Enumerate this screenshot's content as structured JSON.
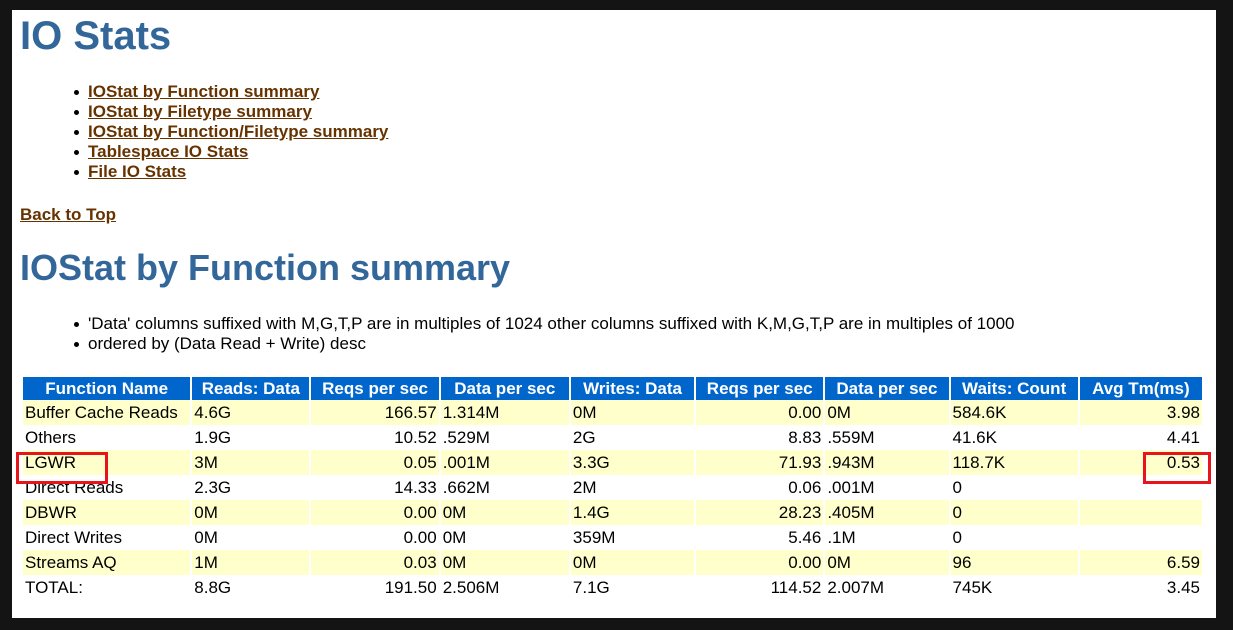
{
  "page_title": "IO Stats",
  "toc": [
    "IOStat by Function summary",
    "IOStat by Filetype summary",
    "IOStat by Function/Filetype summary",
    "Tablespace IO Stats",
    "File IO Stats"
  ],
  "back_to_top": "Back to Top",
  "section_title": "IOStat by Function summary",
  "notes": [
    "'Data' columns suffixed with M,G,T,P are in multiples of 1024 other columns suffixed with K,M,G,T,P are in multiples of 1000",
    "ordered by (Data Read + Write) desc"
  ],
  "table": {
    "headers": [
      "Function Name",
      "Reads: Data",
      "Reqs per sec",
      "Data per sec",
      "Writes: Data",
      "Reqs per sec",
      "Data per sec",
      "Waits: Count",
      "Avg Tm(ms)"
    ],
    "rows": [
      [
        "Buffer Cache Reads",
        "4.6G",
        "166.57",
        "1.314M",
        "0M",
        "0.00",
        "0M",
        "584.6K",
        "3.98"
      ],
      [
        "Others",
        "1.9G",
        "10.52",
        ".529M",
        "2G",
        "8.83",
        ".559M",
        "41.6K",
        "4.41"
      ],
      [
        "LGWR",
        "3M",
        "0.05",
        ".001M",
        "3.3G",
        "71.93",
        ".943M",
        "118.7K",
        "0.53"
      ],
      [
        "Direct Reads",
        "2.3G",
        "14.33",
        ".662M",
        "2M",
        "0.06",
        ".001M",
        "0",
        ""
      ],
      [
        "DBWR",
        "0M",
        "0.00",
        "0M",
        "1.4G",
        "28.23",
        ".405M",
        "0",
        ""
      ],
      [
        "Direct Writes",
        "0M",
        "0.00",
        "0M",
        "359M",
        "5.46",
        ".1M",
        "0",
        ""
      ],
      [
        "Streams AQ",
        "1M",
        "0.03",
        "0M",
        "0M",
        "0.00",
        "0M",
        "96",
        "6.59"
      ],
      [
        "TOTAL:",
        "8.8G",
        "191.50",
        "2.506M",
        "7.1G",
        "114.52",
        "2.007M",
        "745K",
        "3.45"
      ]
    ]
  },
  "colors": {
    "heading": "#336699",
    "link": "#663300",
    "table_header_bg": "#0066cc",
    "row_stripe": "#ffffcc",
    "highlight_box": "#e8141c"
  }
}
